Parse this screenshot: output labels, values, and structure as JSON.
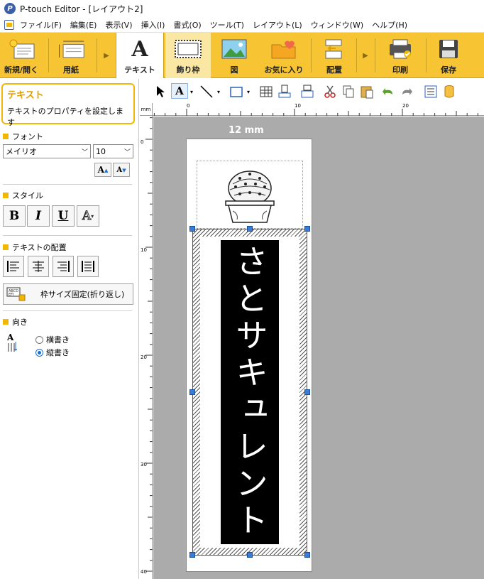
{
  "window": {
    "title": "P-touch Editor - [レイアウト2]",
    "app_icon": "P"
  },
  "menu": [
    "ファイル(F)",
    "編集(E)",
    "表示(V)",
    "挿入(I)",
    "書式(O)",
    "ツール(T)",
    "レイアウト(L)",
    "ウィンドウ(W)",
    "ヘルプ(H)"
  ],
  "ribbon": {
    "items": [
      {
        "label": "新規/開く",
        "icon": "new-open-icon"
      },
      {
        "label": "用紙",
        "icon": "paper-icon"
      },
      {
        "label": "テキスト",
        "icon": "text-icon",
        "state": "active"
      },
      {
        "label": "飾り枠",
        "icon": "frame-icon",
        "state": "hover"
      },
      {
        "label": "図",
        "icon": "picture-icon"
      },
      {
        "label": "お気に入り",
        "icon": "favorites-icon"
      },
      {
        "label": "配置",
        "icon": "arrange-icon"
      },
      {
        "label": "印刷",
        "icon": "print-icon"
      },
      {
        "label": "保存",
        "icon": "save-icon"
      }
    ],
    "text_glyph": "A"
  },
  "properties": {
    "title": "テキスト",
    "description": "テキストのプロパティを設定します",
    "font_section": "フォント",
    "font_name": "メイリオ",
    "font_size": "10",
    "grow_glyph": "A",
    "shrink_glyph": "A",
    "style_section": "スタイル",
    "bold": "B",
    "italic": "I",
    "underline": "U",
    "outline": "A",
    "align_section": "テキストの配置",
    "fixed_frame_label": "枠サイズ固定(折り返し)",
    "orientation_section": "向き",
    "horizontal": "横書き",
    "vertical": "縦書き",
    "selected_orientation": "vertical"
  },
  "ruler": {
    "unit": "mm",
    "top_ticks": [
      "0",
      "10",
      "20"
    ],
    "left_ticks": [
      "0",
      "10",
      "20",
      "30",
      "40"
    ]
  },
  "canvas": {
    "tape_width": "12 mm",
    "label_text": "さとサキュレント",
    "image": "cactus-pot-image"
  }
}
